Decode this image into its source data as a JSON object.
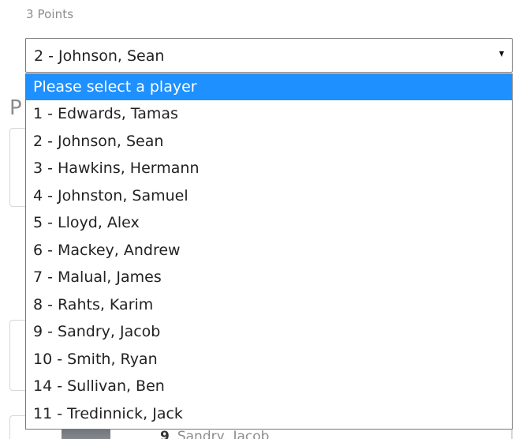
{
  "field": {
    "label": "3 Points",
    "selected_value": "2 - Johnson, Sean"
  },
  "dropdown": {
    "options": [
      "Please select a player",
      "1 - Edwards, Tamas",
      "2 - Johnson, Sean",
      "3 - Hawkins, Hermann",
      "4 - Johnston, Samuel",
      "5 - Lloyd, Alex",
      "6 - Mackey, Andrew",
      "7 - Malual, James",
      "8 - Rahts, Karim",
      "9 - Sandry, Jacob",
      "10 - Smith, Ryan",
      "14 - Sullivan, Ben",
      "11 - Tredinnick, Jack"
    ],
    "highlighted_index": 0,
    "highlight_color": "#1e90ff"
  },
  "background": {
    "heading_letter": "P",
    "player_number": "9",
    "player_name": "Sandry, Jacob"
  }
}
